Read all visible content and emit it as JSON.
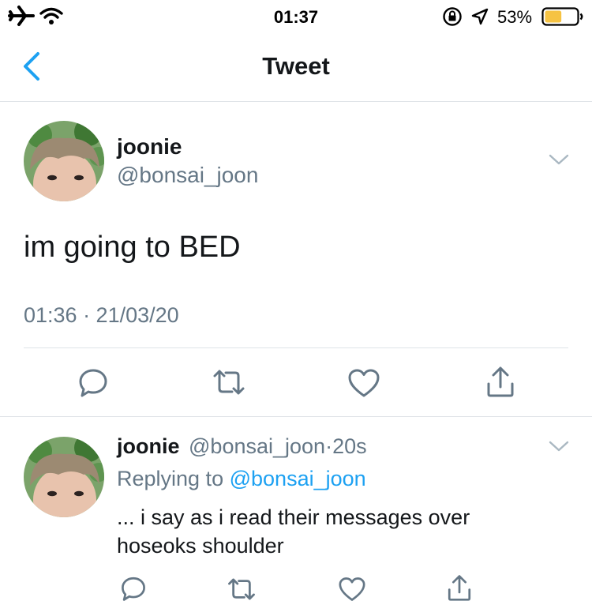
{
  "status_bar": {
    "time": "01:37",
    "battery_percent": "53%",
    "battery_level": 0.53,
    "battery_color": "#f6c343",
    "icons": [
      "airplane-icon",
      "wifi-icon",
      "rotation-lock-icon",
      "location-icon",
      "battery-icon"
    ]
  },
  "nav": {
    "title": "Tweet",
    "back_icon": "chevron-left-icon"
  },
  "main_tweet": {
    "display_name": "joonie",
    "handle": "@bonsai_joon",
    "text": "im going to BED",
    "timestamp": "01:36 · 21/03/20",
    "actions": [
      "reply-icon",
      "retweet-icon",
      "like-icon",
      "share-icon"
    ]
  },
  "reply_tweet": {
    "display_name": "joonie",
    "handle": "@bonsai_joon",
    "separator": "·",
    "age": "20s",
    "replying_prefix": "Replying to",
    "replying_to": "@bonsai_joon",
    "text_line1": "... i say as i read their messages over",
    "text_line2": "hoseoks shoulder"
  },
  "colors": {
    "accent": "#1da1f2",
    "secondary_text": "#657786",
    "divider": "#dfe3e7",
    "icon": "#657786"
  }
}
